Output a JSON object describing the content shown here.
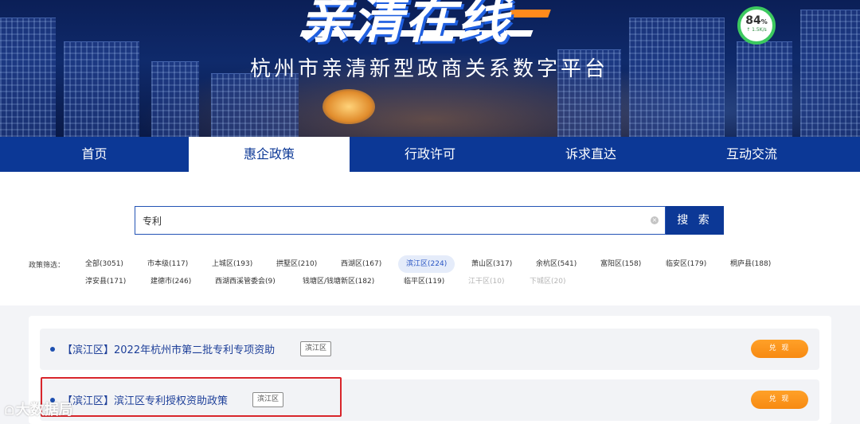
{
  "header": {
    "logo_text": "亲清在线",
    "subtitle": "杭州市亲清新型政商关系数字平台",
    "speed": {
      "percent": "84",
      "percent_unit": "%",
      "rate": "↑ 1.5K/s"
    }
  },
  "nav": {
    "items": [
      {
        "label": "首页",
        "active": false
      },
      {
        "label": "惠企政策",
        "active": true
      },
      {
        "label": "行政许可",
        "active": false
      },
      {
        "label": "诉求直达",
        "active": false
      },
      {
        "label": "互动交流",
        "active": false
      }
    ]
  },
  "search": {
    "value": "专利",
    "button_label": "搜 索"
  },
  "filter": {
    "label": "政策筛选：",
    "options": [
      {
        "label": "全部(3051)",
        "state": "normal"
      },
      {
        "label": "市本级(117)",
        "state": "normal"
      },
      {
        "label": "上城区(193)",
        "state": "normal"
      },
      {
        "label": "拱墅区(210)",
        "state": "normal"
      },
      {
        "label": "西湖区(167)",
        "state": "normal"
      },
      {
        "label": "滨江区(224)",
        "state": "active"
      },
      {
        "label": "萧山区(317)",
        "state": "normal"
      },
      {
        "label": "余杭区(541)",
        "state": "normal"
      },
      {
        "label": "富阳区(158)",
        "state": "normal"
      },
      {
        "label": "临安区(179)",
        "state": "normal"
      },
      {
        "label": "桐庐县(188)",
        "state": "normal"
      },
      {
        "label": "淳安县(171)",
        "state": "normal"
      },
      {
        "label": "建德市(246)",
        "state": "normal"
      },
      {
        "label": "西湖西溪管委会(9)",
        "state": "normal"
      },
      {
        "label": "钱塘区/钱塘新区(182)",
        "state": "normal"
      },
      {
        "label": "临平区(119)",
        "state": "normal"
      },
      {
        "label": "江干区(10)",
        "state": "disabled"
      },
      {
        "label": "下城区(20)",
        "state": "disabled"
      }
    ]
  },
  "results": [
    {
      "title": "【滨江区】2022年杭州市第二批专利专项资助",
      "tag": "滨江区",
      "action": "兑 现"
    },
    {
      "title": "【滨江区】滨江区专利授权资助政策",
      "tag": "滨江区",
      "action": "兑 现"
    }
  ],
  "watermark": {
    "icon": "ᗝ",
    "text": "大数据局"
  },
  "colors": {
    "nav_bg": "#0c3896",
    "accent_orange": "#f78a12",
    "highlight_red": "#d8252b"
  }
}
